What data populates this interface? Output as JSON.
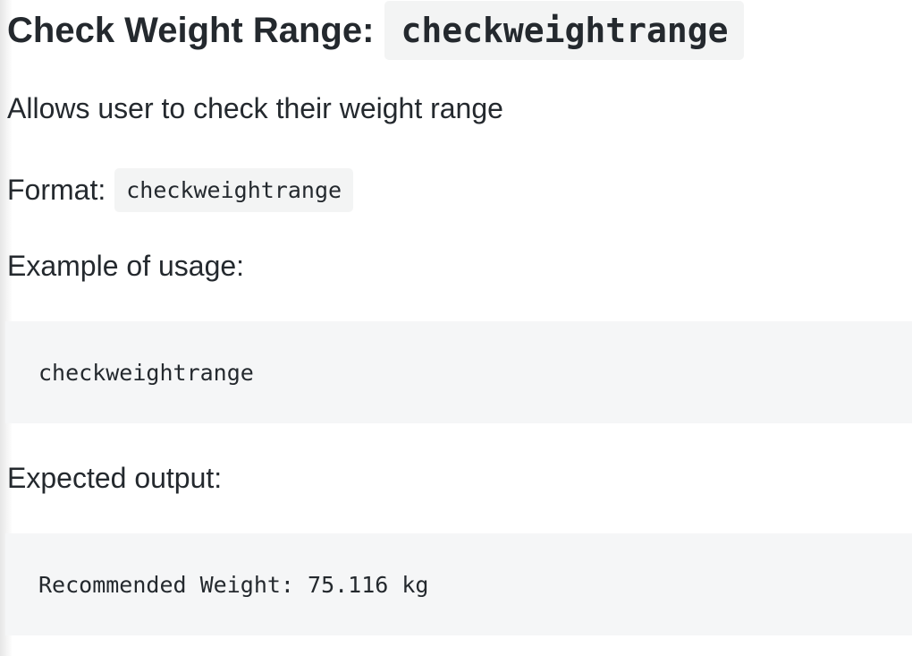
{
  "section": {
    "heading_text": "Check Weight Range:",
    "heading_code": "checkweightrange",
    "description": "Allows user to check their weight range",
    "format_label": "Format:",
    "format_code": "checkweightrange",
    "example_label": "Example of usage:",
    "example_code": "checkweightrange",
    "expected_label": "Expected output:",
    "expected_output": "Recommended Weight: 75.116 kg"
  },
  "colors": {
    "text": "#24292e",
    "code_background": "#f3f4f4",
    "code_block_background": "#f5f6f7",
    "page_background": "#ffffff"
  }
}
